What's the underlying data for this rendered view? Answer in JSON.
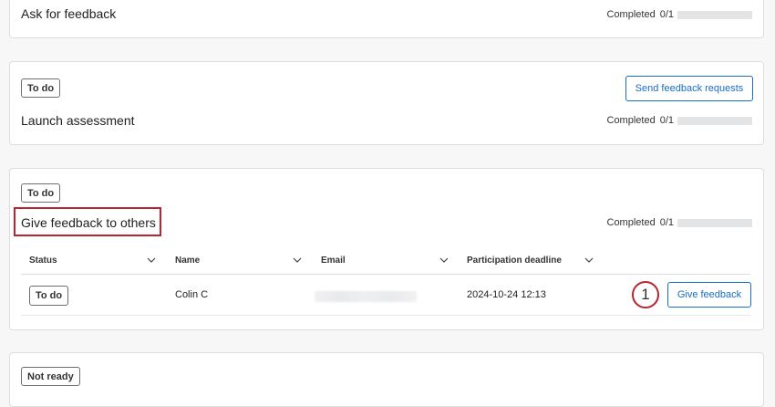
{
  "cards": [
    {
      "title": "Ask for feedback",
      "progress_label": "Completed",
      "progress_count": "0/1",
      "progress_value": 0
    },
    {
      "badge": "To do",
      "title": "Launch assessment",
      "action_label": "Send feedback requests",
      "progress_label": "Completed",
      "progress_count": "0/1",
      "progress_value": 0
    },
    {
      "badge": "To do",
      "title": "Give feedback to others",
      "progress_label": "Completed",
      "progress_count": "0/1",
      "progress_value": 0,
      "table": {
        "columns": [
          "Status",
          "Name",
          "Email",
          "Participation deadline"
        ],
        "rows": [
          {
            "status": "To do",
            "name": "Colin C",
            "email": "",
            "deadline": "2024-10-24 12:13",
            "action_label": "Give feedback"
          }
        ]
      }
    },
    {
      "badge": "Not ready"
    }
  ],
  "annotation": {
    "step_number": "1"
  },
  "colors": {
    "accent": "#1a6dc2",
    "highlight": "#b5262e",
    "progress_track": "#e3e4e6"
  },
  "icons": {
    "column_sort": "chevron-down-icon"
  }
}
